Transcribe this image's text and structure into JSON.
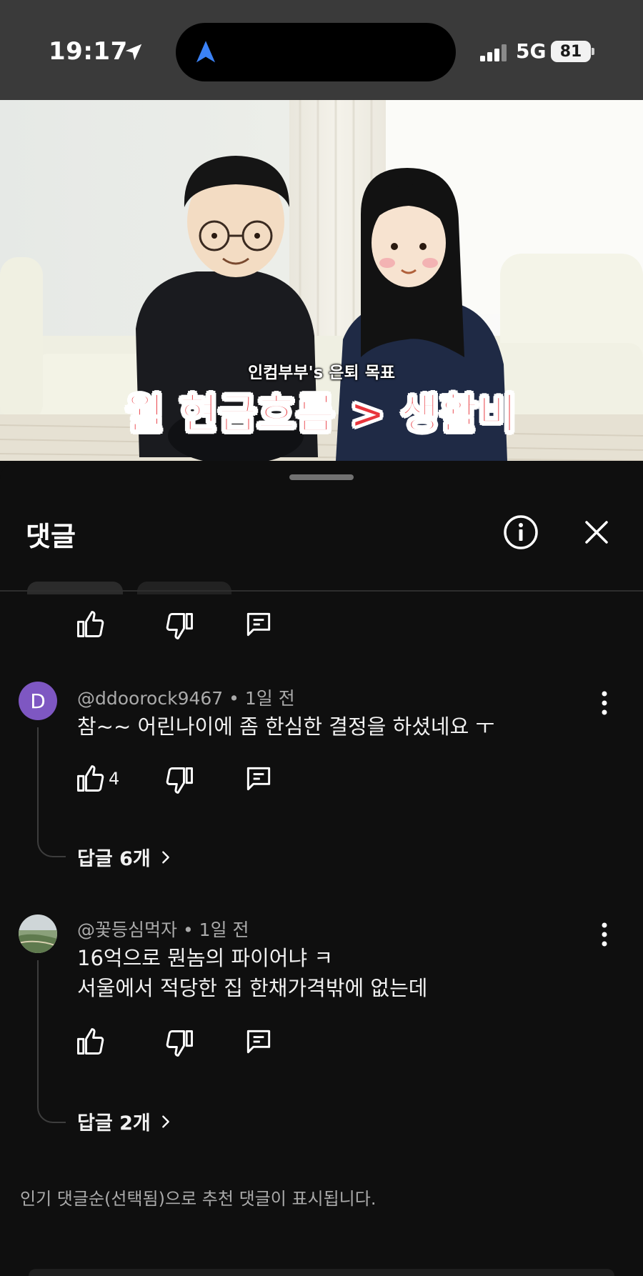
{
  "status_bar": {
    "time": "19:17",
    "network": "5G",
    "battery": "81"
  },
  "video": {
    "caption_small": "인컴부부's 은퇴 목표",
    "caption_big": "월 현금흐름 > 생활비"
  },
  "comments_panel": {
    "title": "댓글",
    "comments": [
      {
        "avatar_letter": "D",
        "author": "@ddoorock9467",
        "time": "1일 전",
        "text_lines": [
          "참~~ 어린나이에 좀 한심한 결정을 하셨네요 ㅜ"
        ],
        "likes": "4",
        "replies": "답글 6개"
      },
      {
        "author": "@꽃등심먹자",
        "time": "1일 전",
        "text_lines": [
          "16억으로 뭔놈의 파이어냐 ㅋ",
          "서울에서 적당한 집 한채가격밖에 없는데"
        ],
        "likes": "",
        "replies": "답글 2개"
      }
    ],
    "footer_note": "인기 댓글순(선택됨)으로 추천 댓글이 표시됩니다."
  },
  "colors": {
    "background": "#0f0f0f",
    "status_bar": "#3a3a3a",
    "avatar_d": "#7e57c2",
    "caption_red": "#e8353c",
    "secondary_text": "#aaaaaa"
  },
  "icons": {
    "location": "location-arrow-icon",
    "navigation": "nav-arrow-icon",
    "info": "info-icon",
    "close": "close-icon",
    "like": "thumbs-up-icon",
    "dislike": "thumbs-down-icon",
    "reply": "comment-icon",
    "more": "more-vert-icon",
    "chevron": "chevron-right-icon"
  }
}
